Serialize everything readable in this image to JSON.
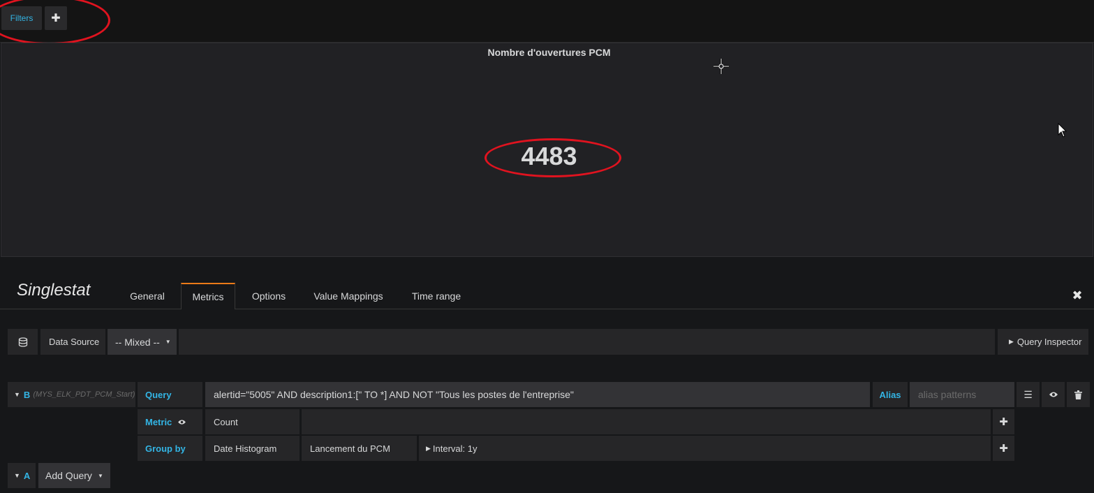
{
  "topbar": {
    "filters_label": "Filters",
    "add_icon": "plus-icon"
  },
  "panel": {
    "title": "Nombre d'ouvertures PCM",
    "value": "4483"
  },
  "editor": {
    "title": "Singlestat",
    "tabs": [
      {
        "label": "General",
        "active": false
      },
      {
        "label": "Metrics",
        "active": true
      },
      {
        "label": "Options",
        "active": false
      },
      {
        "label": "Value Mappings",
        "active": false
      },
      {
        "label": "Time range",
        "active": false
      }
    ],
    "close_icon": "close-icon"
  },
  "datasource": {
    "icon": "database-icon",
    "label": "Data Source",
    "selected": "-- Mixed --",
    "query_inspector": "Query Inspector"
  },
  "query_b": {
    "ref": "B",
    "name": "(MYS_ELK_PDT_PCM_Start)",
    "query_label": "Query",
    "query_value": "alertid=\"5005\"  AND description1:[\" TO *] AND NOT \"Tous les postes de l'entreprise\"",
    "alias_label": "Alias",
    "alias_placeholder": "alias patterns",
    "metric_label": "Metric",
    "metric_value": "Count",
    "group_by_label": "Group by",
    "group_by_type": "Date Histogram",
    "group_by_field": "Lancement du PCM",
    "interval": "Interval: 1y"
  },
  "query_a": {
    "ref": "A",
    "add_query_label": "Add Query"
  },
  "colors": {
    "accent": "#33b5e5",
    "annotation": "#e0131f",
    "tab_active": "#eb7b18"
  }
}
